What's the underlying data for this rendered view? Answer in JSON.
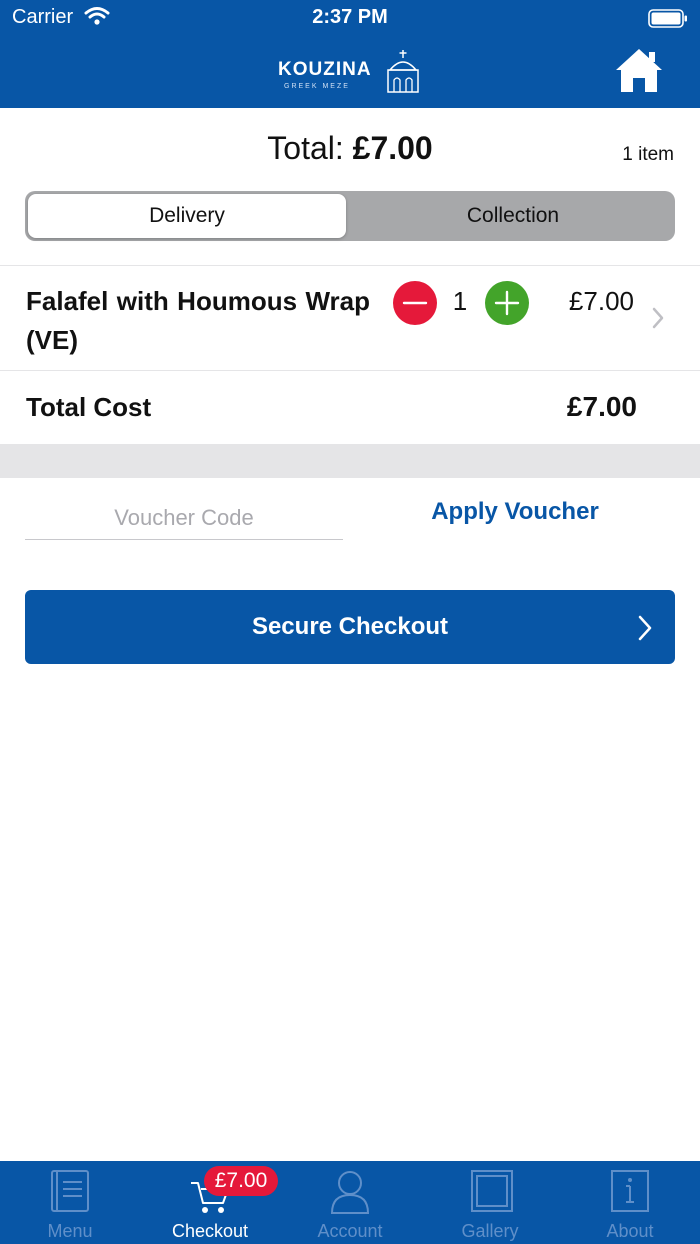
{
  "status_bar": {
    "carrier": "Carrier",
    "time": "2:37 PM"
  },
  "nav": {
    "logo_brand": "KOUZINA",
    "logo_sub": "GREEK MEZE",
    "home_icon": "home-icon"
  },
  "header": {
    "total_label": "Total:",
    "total_value": "£7.00",
    "item_count": "1 item"
  },
  "delivery_toggle": {
    "options": [
      "Delivery",
      "Collection"
    ],
    "selected": "Delivery"
  },
  "cart": {
    "items": [
      {
        "name": "Falafel with Houmous Wrap (VE)",
        "quantity": "1",
        "price": "£7.00"
      }
    ],
    "total_cost_label": "Total Cost",
    "total_cost_value": "£7.00"
  },
  "voucher": {
    "placeholder": "Voucher Code",
    "apply_label": "Apply Voucher"
  },
  "checkout": {
    "label": "Secure Checkout"
  },
  "tab_bar": {
    "tabs": [
      {
        "label": "Menu",
        "icon": "menu-book-icon"
      },
      {
        "label": "Checkout",
        "icon": "cart-icon"
      },
      {
        "label": "Account",
        "icon": "person-icon"
      },
      {
        "label": "Gallery",
        "icon": "gallery-icon"
      },
      {
        "label": "About",
        "icon": "info-icon"
      }
    ],
    "active": "Checkout",
    "cart_badge": "£7.00"
  },
  "colors": {
    "brand_blue": "#0856a6",
    "minus_red": "#e5193a",
    "plus_green": "#43a42a"
  }
}
